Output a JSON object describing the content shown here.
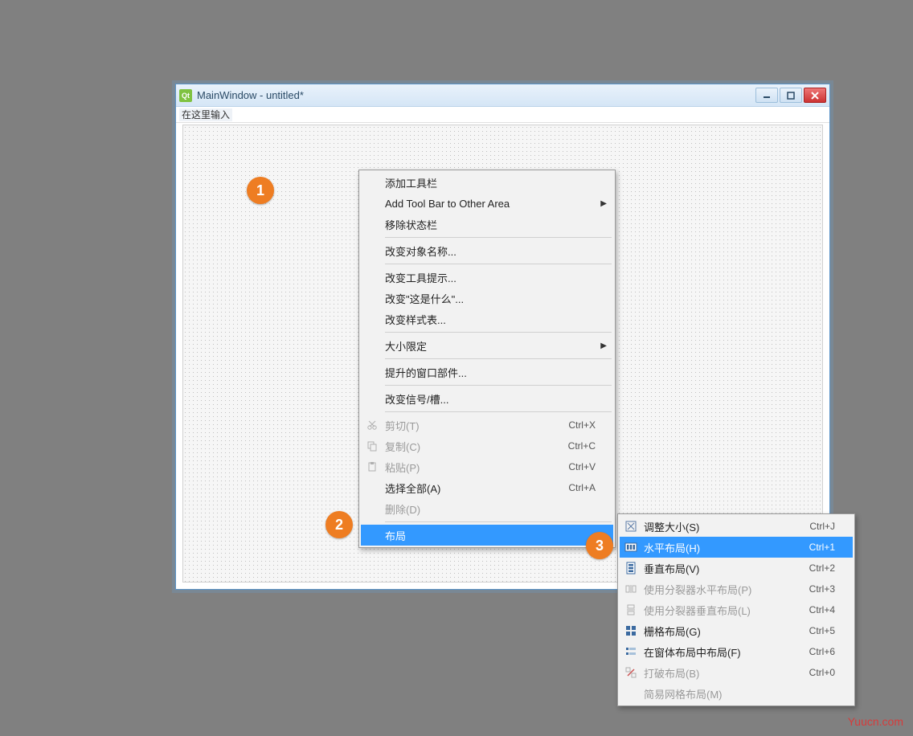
{
  "window": {
    "title": "MainWindow - untitled*",
    "menubar_hint": "在这里输入",
    "qt_label": "Qt"
  },
  "badges": {
    "one": "1",
    "two": "2",
    "three": "3"
  },
  "menu": {
    "add_toolbar": "添加工具栏",
    "add_toolbar_other": "Add Tool Bar to Other Area",
    "remove_statusbar": "移除状态栏",
    "change_object_name": "改变对象名称...",
    "change_tooltip": "改变工具提示...",
    "change_whatsthis": "改变\"这是什么\"...",
    "change_stylesheet": "改变样式表...",
    "size_constraints": "大小限定",
    "promote_widget": "提升的窗口部件...",
    "change_signals_slots": "改变信号/槽...",
    "cut": "剪切(T)",
    "copy": "复制(C)",
    "paste": "粘贴(P)",
    "select_all": "选择全部(A)",
    "delete": "删除(D)",
    "layout": "布局",
    "sc_cut": "Ctrl+X",
    "sc_copy": "Ctrl+C",
    "sc_paste": "Ctrl+V",
    "sc_select_all": "Ctrl+A"
  },
  "submenu": {
    "adjust_size": "调整大小(S)",
    "hlayout": "水平布局(H)",
    "vlayout": "垂直布局(V)",
    "hsplitter": "使用分裂器水平布局(P)",
    "vsplitter": "使用分裂器垂直布局(L)",
    "grid": "栅格布局(G)",
    "form": "在窗体布局中布局(F)",
    "break": "打破布局(B)",
    "simple_grid": "简易网格布局(M)",
    "sc_adjust": "Ctrl+J",
    "sc_h": "Ctrl+1",
    "sc_v": "Ctrl+2",
    "sc_hs": "Ctrl+3",
    "sc_vs": "Ctrl+4",
    "sc_grid": "Ctrl+5",
    "sc_form": "Ctrl+6",
    "sc_break": "Ctrl+0"
  },
  "watermark": "Yuucn.com"
}
